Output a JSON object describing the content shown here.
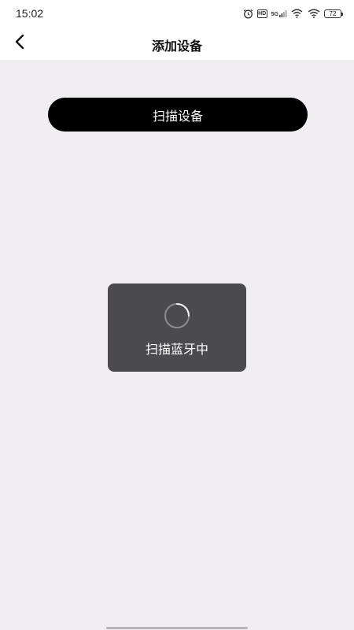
{
  "status_bar": {
    "time": "15:02",
    "hd_label": "HD",
    "network_label": "5G",
    "battery_level": "72",
    "icons": [
      "alarm-icon",
      "hd-icon",
      "5g-signal-icon",
      "wifi-calling-icon",
      "wifi-icon",
      "battery-icon"
    ]
  },
  "header": {
    "title": "添加设备",
    "back_icon": "chevron-left-icon"
  },
  "main": {
    "scan_button_label": "扫描设备"
  },
  "toast": {
    "message": "扫描蓝牙中",
    "spinner_icon": "loading-spinner-icon"
  },
  "colors": {
    "background": "#f0eef0",
    "button": "#000000",
    "toast": "#4b4a4f"
  }
}
